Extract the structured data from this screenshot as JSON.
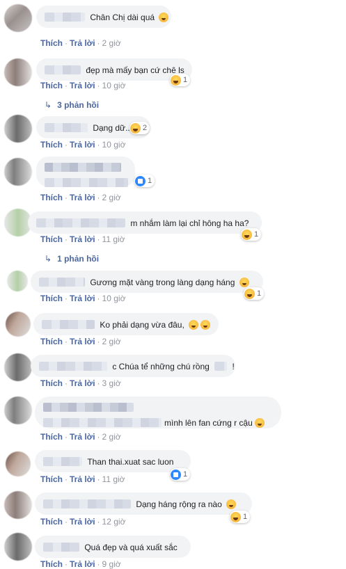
{
  "actions": {
    "like": "Thích",
    "reply": "Trả lời",
    "sep": "·"
  },
  "comments": [
    {
      "text": "Chân Chị dài quá",
      "time": "2 giờ",
      "reaction": null
    },
    {
      "text": "đẹp mà mấy bạn cứ chê ls",
      "time": "10 giờ",
      "reaction": {
        "type": "haha",
        "count": "1"
      }
    },
    {
      "text": "Dạng dữ..",
      "time": "10 giờ",
      "reaction": {
        "type": "haha",
        "count": "2"
      }
    },
    {
      "text": "",
      "time": "2 giờ",
      "reaction": {
        "type": "like",
        "count": "1"
      }
    },
    {
      "text": "m nhắm làm lại chỉ hông ha ha?",
      "time": "11 giờ",
      "reaction": {
        "type": "haha",
        "count": "1"
      }
    },
    {
      "text": "Gương mặt vàng trong làng dạng háng",
      "time": "10 giờ",
      "reaction": {
        "type": "haha",
        "count": "1"
      }
    },
    {
      "text": "Ko phải dạng vừa đâu,",
      "time": "2 giờ",
      "reaction": null
    },
    {
      "text": "c Chúa tể những chú rồng",
      "text_end": "!",
      "time": "3 giờ",
      "reaction": null
    },
    {
      "text": "mình lên fan cứng r cậu",
      "time": "2 giờ",
      "reaction": null
    },
    {
      "text": "Than thai.xuat sac luon",
      "time": "11 giờ",
      "reaction": {
        "type": "like",
        "count": "1"
      }
    },
    {
      "text": "Dạng háng rộng ra nào",
      "time": "12 giờ",
      "reaction": {
        "type": "haha",
        "count": "1"
      }
    },
    {
      "text": "Quá đẹp và quá xuất sắc",
      "time": "9 giờ",
      "reaction": null
    }
  ],
  "replies": [
    {
      "label": "3 phản hồi"
    },
    {
      "label": "1 phản hồi"
    }
  ],
  "colors": {
    "link": "#4b67a1",
    "bubble": "#f2f3f5",
    "muted": "#90949c"
  },
  "icons": {
    "reply_arrow": "reply-arrow-icon",
    "haha": "haha-reaction-icon",
    "like": "like-reaction-icon"
  }
}
